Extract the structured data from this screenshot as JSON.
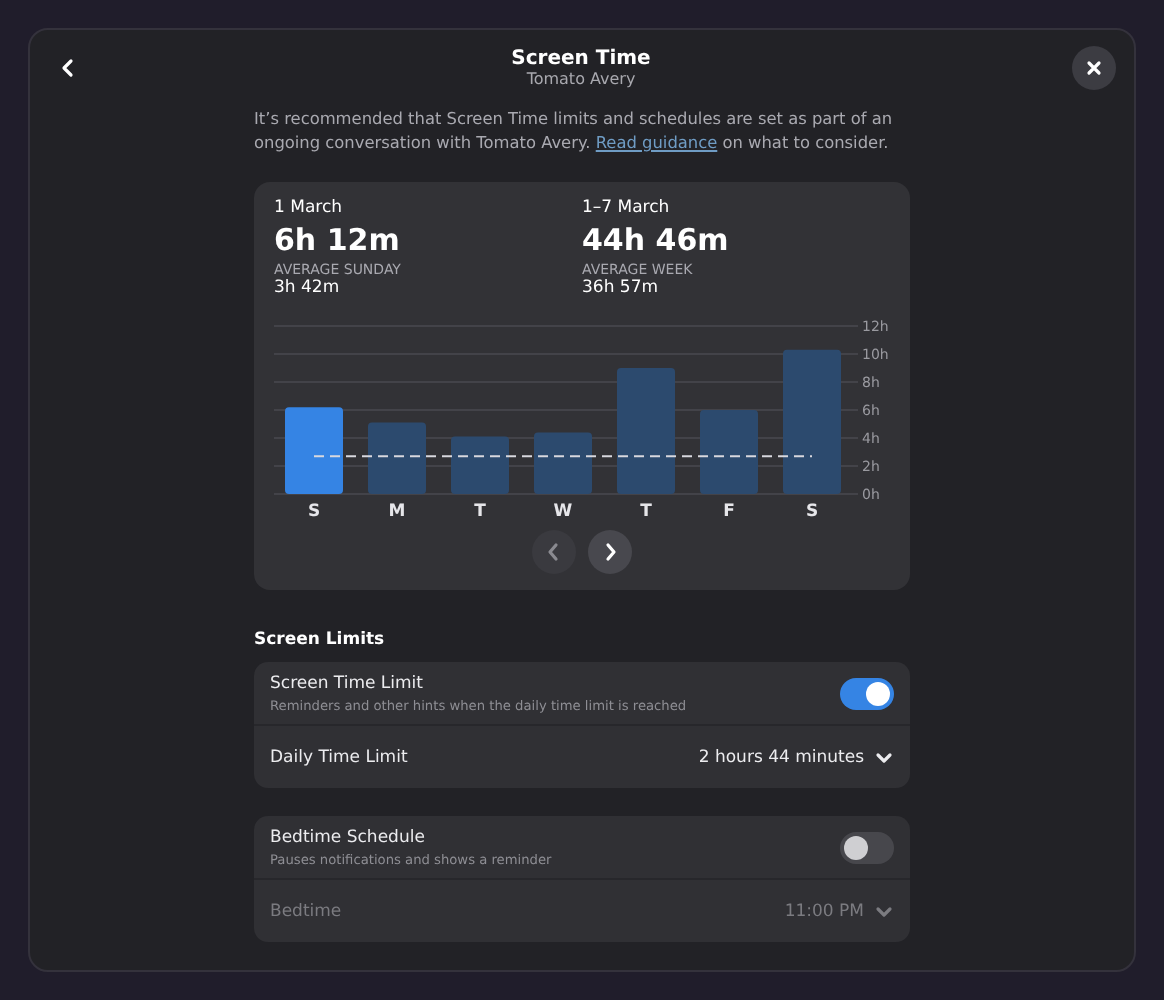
{
  "window": {
    "title": "Screen Time",
    "subtitle": "Tomato Avery"
  },
  "intro": {
    "text": "It’s recommended that Screen Time limits and schedules are set as part of an ongoing conversation with Tomato Avery.",
    "link": "Read guidance",
    "after": "on what to consider."
  },
  "summary": [
    {
      "date": "1 March",
      "total": "6h 12m",
      "average_label": "AVERAGE SUNDAY",
      "average": "3h 42m"
    },
    {
      "date": "1–7 March",
      "total": "44h 46m",
      "average_label": "AVERAGE WEEK",
      "average": "36h 57m"
    }
  ],
  "chart": {
    "chart_data": {
      "type": "bar",
      "categories": [
        "S",
        "M",
        "T",
        "W",
        "T",
        "F",
        "S"
      ],
      "grid": true,
      "series": [
        {
          "color": "#3584e4",
          "values": [
            6.2,
            null,
            null,
            null,
            null,
            null,
            null
          ]
        },
        {
          "color": "#2c4a6e",
          "values": [
            null,
            5.1,
            4.1,
            4.4,
            9.0,
            6.0,
            10.3
          ]
        },
        {
          "type": "line",
          "line_style": "dashed",
          "color": "#d8d8de",
          "values": [
            2.7,
            2.7,
            2.7,
            2.7,
            2.7,
            2.7,
            2.7
          ]
        }
      ],
      "ylim": [
        0,
        12
      ],
      "yticks": [
        {
          "value": 0,
          "label": "0h"
        },
        {
          "value": 2,
          "label": "2h"
        },
        {
          "value": 4,
          "label": "4h"
        },
        {
          "value": 6,
          "label": "6h"
        },
        {
          "value": 8,
          "label": "8h"
        },
        {
          "value": 10,
          "label": "10h"
        },
        {
          "value": 12,
          "label": "12h"
        }
      ]
    }
  },
  "section_title": "Screen Limits",
  "groups": [
    {
      "rows": [
        {
          "kind": "toggle",
          "title": "Screen Time Limit",
          "subtitle": "Reminders and other hints when the daily time limit is reached",
          "on": true,
          "disabled": false
        },
        {
          "kind": "dropdown",
          "title": "Daily Time Limit",
          "value": "2 hours 44 minutes",
          "disabled": false
        }
      ]
    },
    {
      "rows": [
        {
          "kind": "toggle",
          "title": "Bedtime Schedule",
          "subtitle": "Pauses notifications and shows a reminder",
          "on": false,
          "disabled": false
        },
        {
          "kind": "dropdown",
          "title": "Bedtime",
          "value": "11:00 PM",
          "disabled": true
        }
      ]
    }
  ]
}
